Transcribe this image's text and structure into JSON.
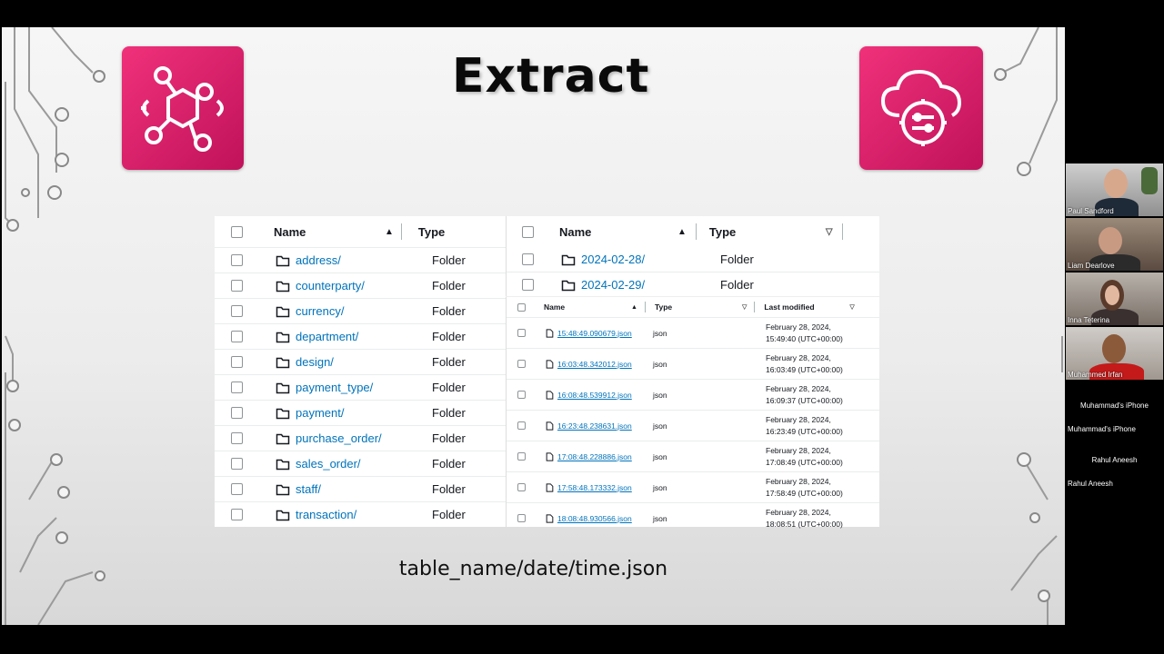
{
  "slide": {
    "title": "Extract",
    "caption": "table_name/date/time.json"
  },
  "left_table": {
    "headers": {
      "name": "Name",
      "type": "Type"
    },
    "rows": [
      {
        "name": "address/",
        "type": "Folder"
      },
      {
        "name": "counterparty/",
        "type": "Folder"
      },
      {
        "name": "currency/",
        "type": "Folder"
      },
      {
        "name": "department/",
        "type": "Folder"
      },
      {
        "name": "design/",
        "type": "Folder"
      },
      {
        "name": "payment_type/",
        "type": "Folder"
      },
      {
        "name": "payment/",
        "type": "Folder"
      },
      {
        "name": "purchase_order/",
        "type": "Folder"
      },
      {
        "name": "sales_order/",
        "type": "Folder"
      },
      {
        "name": "staff/",
        "type": "Folder"
      },
      {
        "name": "transaction/",
        "type": "Folder"
      }
    ]
  },
  "date_table": {
    "headers": {
      "name": "Name",
      "type": "Type"
    },
    "rows": [
      {
        "name": "2024-02-28/",
        "type": "Folder"
      },
      {
        "name": "2024-02-29/",
        "type": "Folder"
      }
    ]
  },
  "file_table": {
    "headers": {
      "name": "Name",
      "type": "Type",
      "modified": "Last modified"
    },
    "rows": [
      {
        "name": "15:48:49.090679.json",
        "type": "json",
        "date": "February 28, 2024,",
        "time": "15:49:40 (UTC+00:00)"
      },
      {
        "name": "16:03:48.342012.json",
        "type": "json",
        "date": "February 28, 2024,",
        "time": "16:03:49 (UTC+00:00)"
      },
      {
        "name": "16:08:48.539912.json",
        "type": "json",
        "date": "February 28, 2024,",
        "time": "16:09:37 (UTC+00:00)"
      },
      {
        "name": "16:23:48.238631.json",
        "type": "json",
        "date": "February 28, 2024,",
        "time": "16:23:49 (UTC+00:00)"
      },
      {
        "name": "17:08:48.228886.json",
        "type": "json",
        "date": "February 28, 2024,",
        "time": "17:08:49 (UTC+00:00)"
      },
      {
        "name": "17:58:48.173332.json",
        "type": "json",
        "date": "February 28, 2024,",
        "time": "17:58:49 (UTC+00:00)"
      },
      {
        "name": "18:08:48.930566.json",
        "type": "json",
        "date": "February 28, 2024,",
        "time": "18:08:51 (UTC+00:00)"
      }
    ]
  },
  "participants": [
    {
      "name": "Paul Sandford"
    },
    {
      "name": "Liam Dearlove"
    },
    {
      "name": "Inna Teterina"
    },
    {
      "name": "Muhammed Irfan"
    },
    {
      "center": "Muhammad's iPhone",
      "name": "Muhammad's iPhone"
    },
    {
      "center": "Rahul Aneesh",
      "name": "Rahul Aneesh"
    }
  ],
  "colors": {
    "accent_pink": "#e7157b",
    "link_blue": "#0073bb"
  },
  "icons": [
    "eventbridge-icon",
    "cloud-settings-icon"
  ]
}
